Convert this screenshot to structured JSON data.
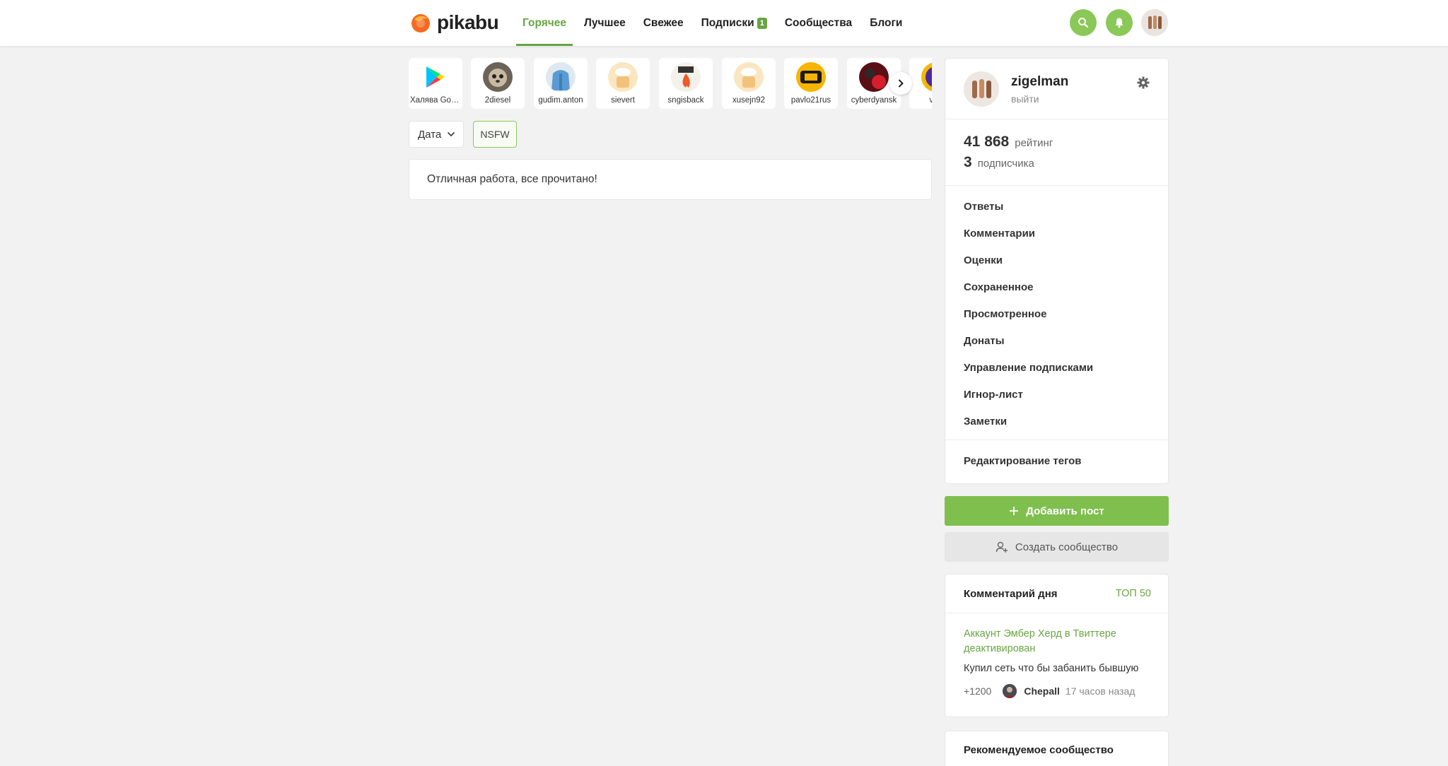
{
  "header": {
    "logo_text": "pikabu",
    "nav": [
      {
        "label": "Горячее",
        "active": true
      },
      {
        "label": "Лучшее"
      },
      {
        "label": "Свежее"
      },
      {
        "label": "Подписки",
        "badge": "1"
      },
      {
        "label": "Сообщества"
      },
      {
        "label": "Блоги"
      }
    ],
    "icons": [
      "search-icon",
      "bell-icon"
    ],
    "accent": "#67a543"
  },
  "stories": [
    {
      "label": "Халява Google Play",
      "icon": "google-play-icon"
    },
    {
      "label": "2diesel"
    },
    {
      "label": "gudim.anton"
    },
    {
      "label": "sievert"
    },
    {
      "label": "sngisback"
    },
    {
      "label": "xusejn92"
    },
    {
      "label": "pavlo21rus"
    },
    {
      "label": "cyberdyansk"
    },
    {
      "label": "vrm"
    }
  ],
  "filters": {
    "date_label": "Дата",
    "nsfw_label": "NSFW"
  },
  "feed": {
    "empty_message": "Отличная работа, все прочитано!"
  },
  "profile": {
    "username": "zigelman",
    "logout": "выйти",
    "rating_value": "41 868",
    "rating_label": "рейтинг",
    "subscribers_value": "3",
    "subscribers_label": "подписчика",
    "menu": [
      "Ответы",
      "Комментарии",
      "Оценки",
      "Сохраненное",
      "Просмотренное",
      "Донаты",
      "Управление подписками",
      "Игнор-лист",
      "Заметки"
    ],
    "menu_extra": [
      "Редактирование тегов"
    ]
  },
  "actions": {
    "add_post": "Добавить пост",
    "create_community": "Создать сообщество"
  },
  "comment_of_day": {
    "title": "Комментарий дня",
    "top_link": "ТОП 50",
    "post_title": "Аккаунт Эмбер Херд в Твиттере деактивирован",
    "text": "Купил сеть что бы забанить бывшую",
    "score": "+1200",
    "author": "Chepall",
    "time": "17 часов назад"
  },
  "recommended": {
    "title": "Рекомендуемое сообщество"
  }
}
